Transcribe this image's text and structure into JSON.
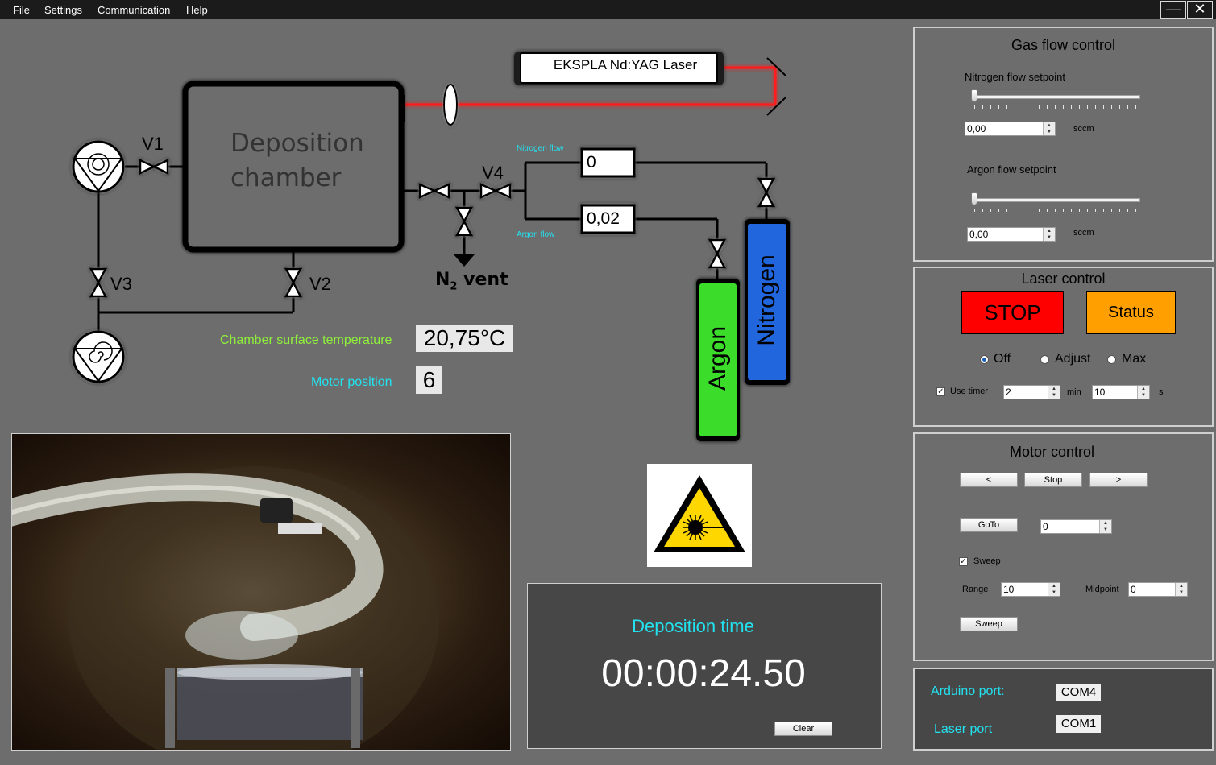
{
  "menu": {
    "file": "File",
    "settings": "Settings",
    "communication": "Communication",
    "help": "Help"
  },
  "window": {
    "minimize": "—",
    "close": "✕"
  },
  "diagram": {
    "laser_label": "EKSPLA Nd:YAG Laser",
    "chamber_line1": "Deposition",
    "chamber_line2": "chamber",
    "v1": "V1",
    "v2": "V2",
    "v3": "V3",
    "v4": "V4",
    "n2": "N",
    "n2_sub": "2",
    "vent": "vent",
    "nitrogen_flow_label": "Nitrogen flow",
    "argon_flow_label": "Argon flow",
    "nitrogen_flow_value": "0",
    "argon_flow_value": "0,02",
    "argon_cylinder": "Argon",
    "nitrogen_cylinder": "Nitrogen"
  },
  "readouts": {
    "temperature_label": "Chamber surface temperature",
    "temperature_value": "20,75°C",
    "motor_label": "Motor position",
    "motor_value": "6"
  },
  "deposition": {
    "title": "Deposition time",
    "time": "00:00:24.50",
    "clear": "Clear"
  },
  "gas": {
    "title": "Gas flow control",
    "nitrogen_setpoint_label": "Nitrogen flow setpoint",
    "nitrogen_value": "0,00",
    "nitrogen_level": 0,
    "argon_setpoint_label": "Argon flow setpoint",
    "argon_value": "0,00",
    "argon_level": 0,
    "unit": "sccm"
  },
  "laser": {
    "title": "Laser control",
    "stop": "STOP",
    "status": "Status",
    "off": "Off",
    "adjust": "Adjust",
    "max": "Max",
    "selected": "Off",
    "use_timer": "Use timer",
    "use_timer_checked": true,
    "minutes": "2",
    "min_unit": "min",
    "seconds": "10",
    "sec_unit": "s"
  },
  "motor": {
    "title": "Motor control",
    "left": "<",
    "stop": "Stop",
    "right": ">",
    "goto": "GoTo",
    "goto_value": "0",
    "sweep_check": "Sweep",
    "sweep_checked": true,
    "range_label": "Range",
    "range_value": "10",
    "midpoint_label": "Midpoint",
    "midpoint_value": "0",
    "sweep_button": "Sweep"
  },
  "ports": {
    "arduino_label": "Arduino port:",
    "arduino_value": "COM4",
    "laser_label": "Laser port",
    "laser_value": "COM1"
  },
  "colors": {
    "stop": "#ff0000",
    "status": "#ff9f00",
    "argon": "#3bdc2b",
    "nitrogen": "#2266dd",
    "cyan": "#22e2f0",
    "lime": "#8ff03a",
    "laser_beam": "#ff1a1a"
  }
}
